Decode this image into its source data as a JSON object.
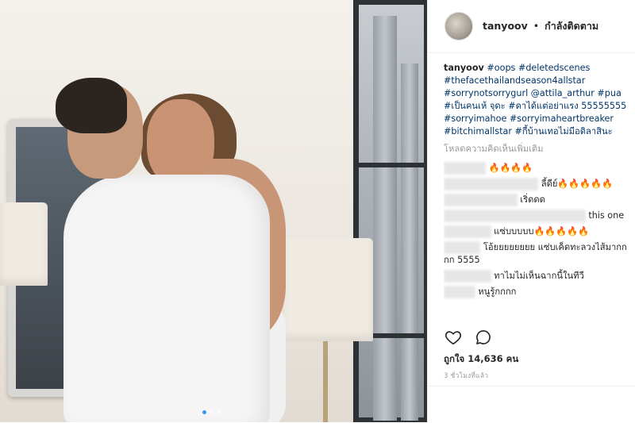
{
  "header": {
    "username": "tanyoov",
    "separator": "•",
    "follow_status": "กำลังติดตาม"
  },
  "caption": {
    "username": "tanyoov",
    "text": "#oops #deletedscenes #thefacethailandseason4allstar #sorrynotsorrygurl @attila_arthur #pua #เป็นคนเห้ จุดะ #ดาได้แต่อย่าแรง 55555555 #sorryimahoe #sorryimaheartbreaker #bitchimallstar #กี้บ้านเทอไม่มีอดิลาสินะ"
  },
  "load_more": "โหลดความคิดเห็นเพิ่มเติม",
  "comments": [
    {
      "text": "🔥🔥🔥🔥"
    },
    {
      "text": "ลี้ดีย์🔥🔥🔥🔥🔥"
    },
    {
      "text": "เริ่ดดด"
    },
    {
      "text": "this one"
    },
    {
      "text": "แซ่บบบบบ🔥🔥🔥🔥🔥"
    },
    {
      "text": "โอ้ยยยยยยยย แซ่บเค็ดทะลวงไส้มากกกก 5555"
    },
    {
      "text": "ทาไมไม่เห็นฉากนี้ในทีวี"
    },
    {
      "text": "หนูรู้กกกก"
    }
  ],
  "likes": {
    "label": "ถูกใจ 14,636 คน"
  },
  "timestamp": "3 ชั่วโมงที่แล้ว",
  "icons": {
    "like": "heart-icon",
    "comment": "comment-icon"
  },
  "colors": {
    "hashtag": "#003569",
    "text": "#262626",
    "muted": "#999999",
    "border": "#efefef"
  }
}
